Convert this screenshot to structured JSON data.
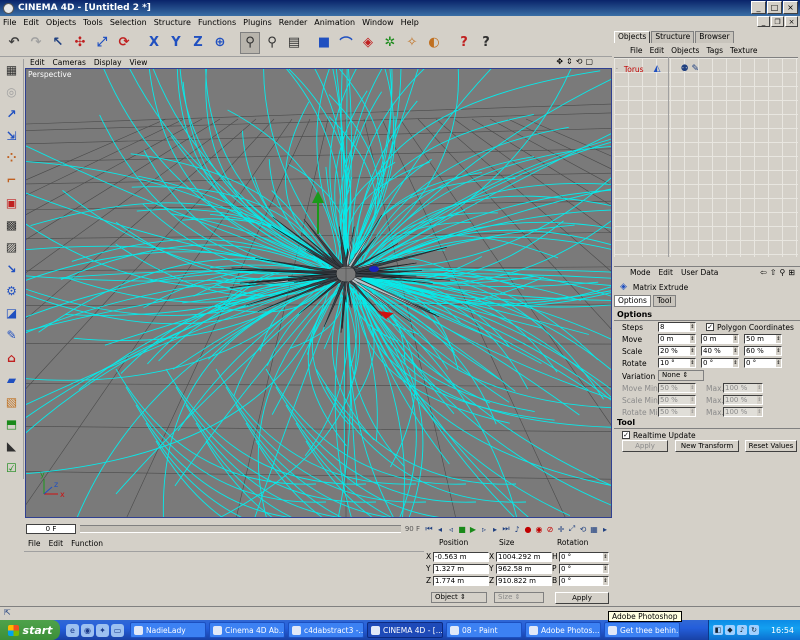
{
  "titlebar": {
    "title": "CINEMA 4D - [Untitled 2 *]"
  },
  "menubar": [
    "File",
    "Edit",
    "Objects",
    "Tools",
    "Selection",
    "Structure",
    "Functions",
    "Plugins",
    "Render",
    "Animation",
    "Window",
    "Help"
  ],
  "viewport": {
    "menu": [
      "Edit",
      "Cameras",
      "Display",
      "View"
    ],
    "label": "Perspective"
  },
  "timeline": {
    "current_frame": "0 F",
    "end_frame": "90 F"
  },
  "material_manager": {
    "menu": [
      "File",
      "Edit",
      "Function"
    ]
  },
  "coordinates": {
    "headers": {
      "position": "Position",
      "size": "Size",
      "rotation": "Rotation"
    },
    "rows": [
      {
        "axis": "X",
        "position": "-0.563 m",
        "size": "1004.292 m",
        "rot_axis": "H",
        "rotation": "0 °"
      },
      {
        "axis": "Y",
        "position": "1.327 m",
        "size": "962.58 m",
        "rot_axis": "P",
        "rotation": "0 °"
      },
      {
        "axis": "Z",
        "position": "1.774 m",
        "size": "910.822 m",
        "rot_axis": "B",
        "rotation": "0 °"
      }
    ],
    "mode": "Object",
    "size_mode": "Size",
    "apply": "Apply"
  },
  "object_manager": {
    "tabs": [
      "Objects",
      "Structure",
      "Browser"
    ],
    "active_tab": "Objects",
    "menu": [
      "File",
      "Edit",
      "Objects",
      "Tags",
      "Texture"
    ],
    "objects": [
      {
        "name": "Torus"
      }
    ]
  },
  "attribute_manager": {
    "menu": [
      "Mode",
      "Edit",
      "User Data"
    ],
    "tool_name": "Matrix Extrude",
    "tabs": [
      "Options",
      "Tool"
    ],
    "options_section": "Options",
    "steps_label": "Steps",
    "steps_value": "8",
    "polygon_coordinates_label": "Polygon Coordinates",
    "move_label": "Move",
    "move": [
      "0 m",
      "0 m",
      "50 m"
    ],
    "scale_label": "Scale",
    "scale": [
      "20 %",
      "40 %",
      "60 %"
    ],
    "rotate_label": "Rotate",
    "rotate": [
      "10 °",
      "0 °",
      "0 °"
    ],
    "variation_label": "Variation",
    "variation_value": "None",
    "move_min_label": "Move Min.",
    "move_min": "50 %",
    "move_max_label": "Max.",
    "move_max": "100 %",
    "scale_min_label": "Scale Min.",
    "scale_min": "50 %",
    "scale_max_label": "Max.",
    "scale_max": "100 %",
    "rotate_min_label": "Rotate Min.",
    "rotate_min": "50 %",
    "rotate_max_label": "Max.",
    "rotate_max": "100 %",
    "tool_section": "Tool",
    "realtime_update_label": "Realtime Update",
    "apply_button": "Apply",
    "new_transform_button": "New Transform",
    "reset_values_button": "Reset Values"
  },
  "tooltip": "Adobe Photoshop",
  "taskbar": {
    "start": "start",
    "tasks": [
      {
        "label": "NadieLady",
        "active": false
      },
      {
        "label": "Cinema 4D Ab...",
        "active": false
      },
      {
        "label": "c4dabstract3 -...",
        "active": false
      },
      {
        "label": "CINEMA 4D - [...",
        "active": true
      },
      {
        "label": "08 - Paint",
        "active": false
      },
      {
        "label": "Adobe Photos...",
        "active": false
      },
      {
        "label": "Get thee behin...",
        "active": false
      }
    ],
    "clock": "16:54"
  },
  "colors": {
    "wire": "#00f0f0",
    "viewport_bg": "#7a7a7a",
    "object_name": "#c00000"
  }
}
